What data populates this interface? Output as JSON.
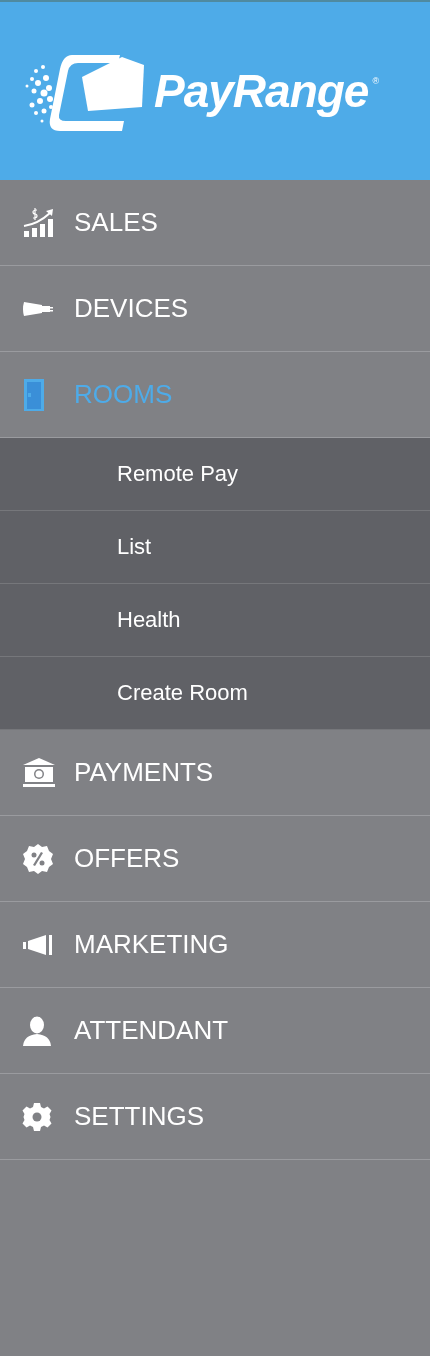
{
  "logo": {
    "name": "PayRange",
    "mark": "®"
  },
  "menu": [
    {
      "label": "SALES",
      "selected": false
    },
    {
      "label": "DEVICES",
      "selected": false
    },
    {
      "label": "ROOMS",
      "selected": true,
      "expanded": true,
      "children": [
        {
          "label": "Remote Pay"
        },
        {
          "label": "List"
        },
        {
          "label": "Health"
        },
        {
          "label": "Create Room"
        }
      ]
    },
    {
      "label": "PAYMENTS",
      "selected": false
    },
    {
      "label": "OFFERS",
      "selected": false
    },
    {
      "label": "MARKETING",
      "selected": false
    },
    {
      "label": "ATTENDANT",
      "selected": false
    },
    {
      "label": "SETTINGS",
      "selected": false
    }
  ]
}
